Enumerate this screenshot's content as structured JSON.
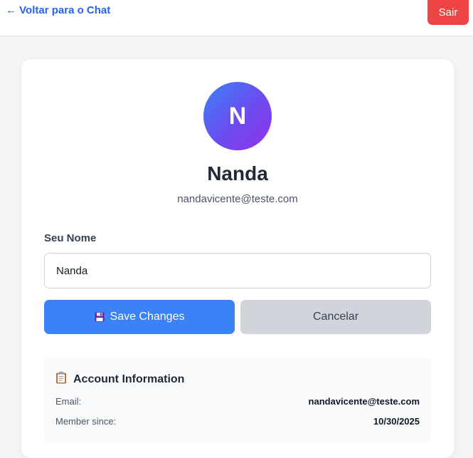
{
  "header": {
    "back_label": "← Voltar para o Chat",
    "logout_label": "Sair"
  },
  "profile": {
    "initial": "N",
    "name": "Nanda",
    "email": "nandavicente@teste.com"
  },
  "form": {
    "name_label": "Seu Nome",
    "name_value": "Nanda",
    "save_label": "Save Changes",
    "save_icon": "floppy-disk-icon",
    "cancel_label": "Cancelar"
  },
  "account_info": {
    "title": "Account Information",
    "title_icon": "clipboard-icon",
    "rows": [
      {
        "label": "Email:",
        "value": "nandavicente@teste.com"
      },
      {
        "label": "Member since:",
        "value": "10/30/2025"
      }
    ]
  },
  "colors": {
    "accent": "#3b82f6",
    "link": "#2563eb",
    "danger": "#ef4444",
    "avatar_gradient_start": "#3b82f6",
    "avatar_gradient_end": "#9333ea"
  }
}
